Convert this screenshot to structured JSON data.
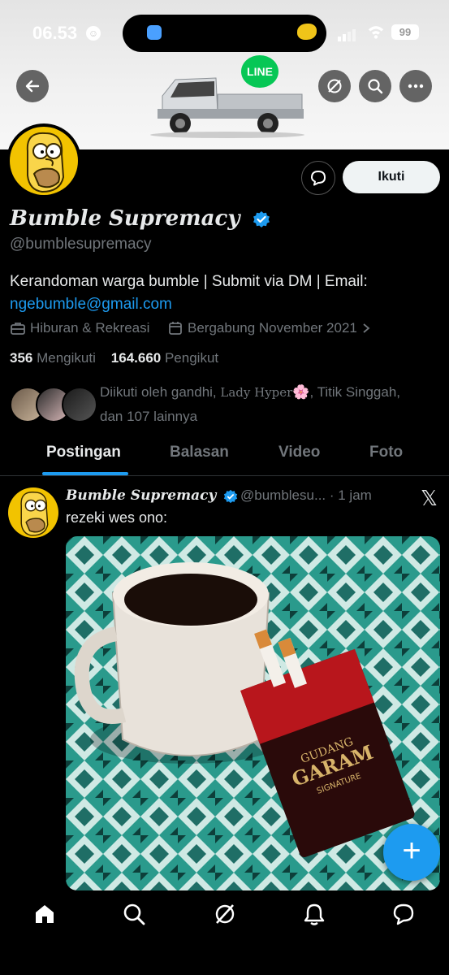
{
  "status_bar": {
    "time": "06.53",
    "battery": "99"
  },
  "banner": {
    "line_logo": "LINE"
  },
  "header_icons": [
    "back-arrow-icon",
    "grok-icon",
    "search-icon",
    "more-icon"
  ],
  "profile": {
    "follow_label": "Ikuti",
    "name": "Bumble Supremacy",
    "handle": "@bumblesupremacy",
    "bio_text": "Kerandoman warga bumble | Submit via DM | Email:",
    "bio_email": "ngebumble@gmail.com",
    "category": "Hiburan & Rekreasi",
    "joined": "Bergabung November 2021",
    "following_count": "356",
    "following_label": "Mengikuti",
    "followers_count": "164.660",
    "followers_label": "Pengikut",
    "followed_by_prefix": "Diikuti oleh gandhi, ",
    "followed_by_styled": "Lady Hyper",
    "followed_by_suffix": ", Titik Singgah,",
    "followed_by_line2": "dan 107 lainnya"
  },
  "tabs": [
    {
      "label": "Postingan",
      "active": true
    },
    {
      "label": "Balasan",
      "active": false
    },
    {
      "label": "Video",
      "active": false
    },
    {
      "label": "Foto",
      "active": false
    }
  ],
  "post": {
    "name": "Bumble Supremacy",
    "handle_time": "@bumblesu... · 1 jam",
    "text": "rezeki wes ono:",
    "image_pack_brand": "GUDANG",
    "image_pack_name": "GARAM",
    "image_pack_sub": "SIGNATURE"
  },
  "fab_label": "+",
  "colors": {
    "accent": "#1d9bf0",
    "background": "#000000",
    "muted": "#71767b"
  }
}
